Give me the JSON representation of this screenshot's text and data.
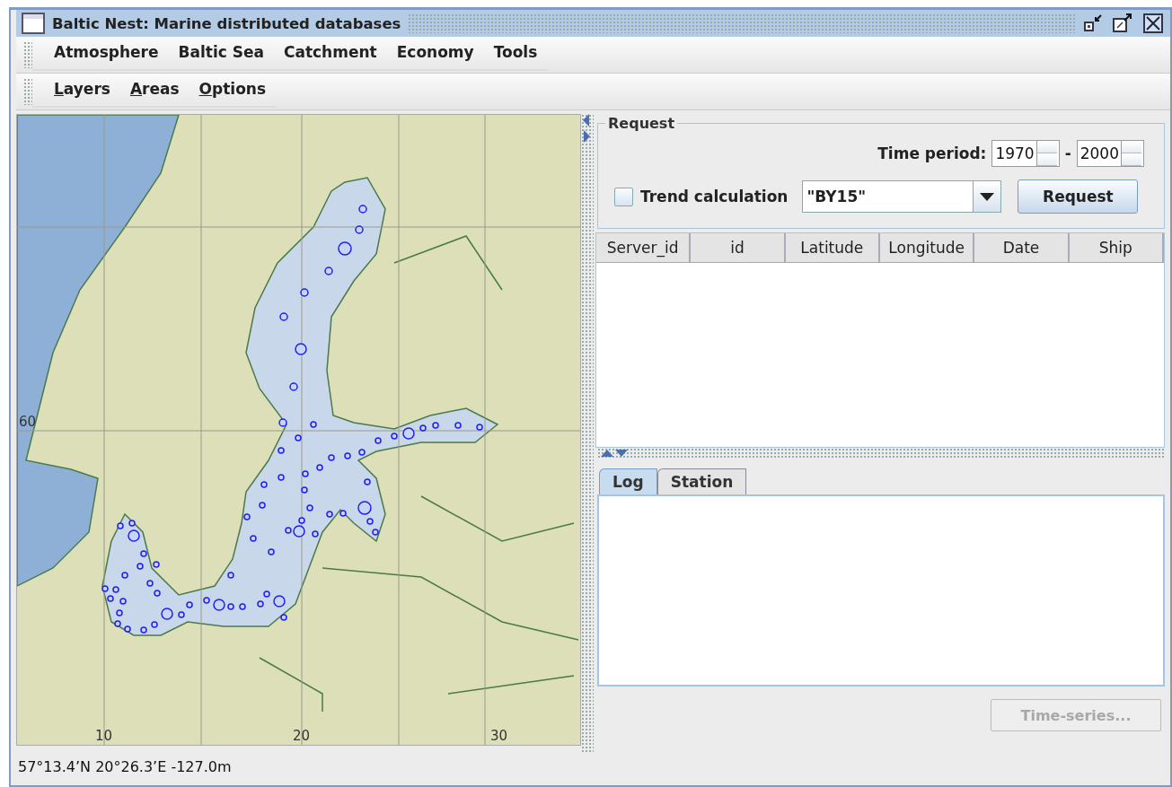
{
  "window": {
    "title": "Baltic Nest: Marine distributed databases"
  },
  "menu_bar": [
    "Atmosphere",
    "Baltic Sea",
    "Catchment",
    "Economy",
    "Tools"
  ],
  "toolbar_menus": [
    {
      "label": "Layers"
    },
    {
      "label": "Areas"
    },
    {
      "label": "Options"
    }
  ],
  "map": {
    "grid_labels": [
      {
        "label": "60",
        "kind": "latitude"
      },
      {
        "label": "10",
        "kind": "longitude"
      },
      {
        "label": "20",
        "kind": "longitude"
      },
      {
        "label": "30",
        "kind": "longitude"
      }
    ]
  },
  "request": {
    "title": "Request",
    "time_period_label": "Time period:",
    "from": "1970",
    "separator": "-",
    "to": "2000",
    "trend": {
      "label": "Trend calculation",
      "checked": false
    },
    "station_select": {
      "value": "\"BY15\""
    },
    "button": "Request"
  },
  "table": {
    "columns": [
      "Server_id",
      "id",
      "Latitude",
      "Longitude",
      "Date",
      "Ship"
    ]
  },
  "tabs": [
    {
      "label": "Log",
      "selected": true
    },
    {
      "label": "Station",
      "selected": false
    }
  ],
  "time_series_button": {
    "label": "Time-series...",
    "disabled": true
  },
  "status_bar": "57°13.4’N 20°26.3’E -127.0m"
}
